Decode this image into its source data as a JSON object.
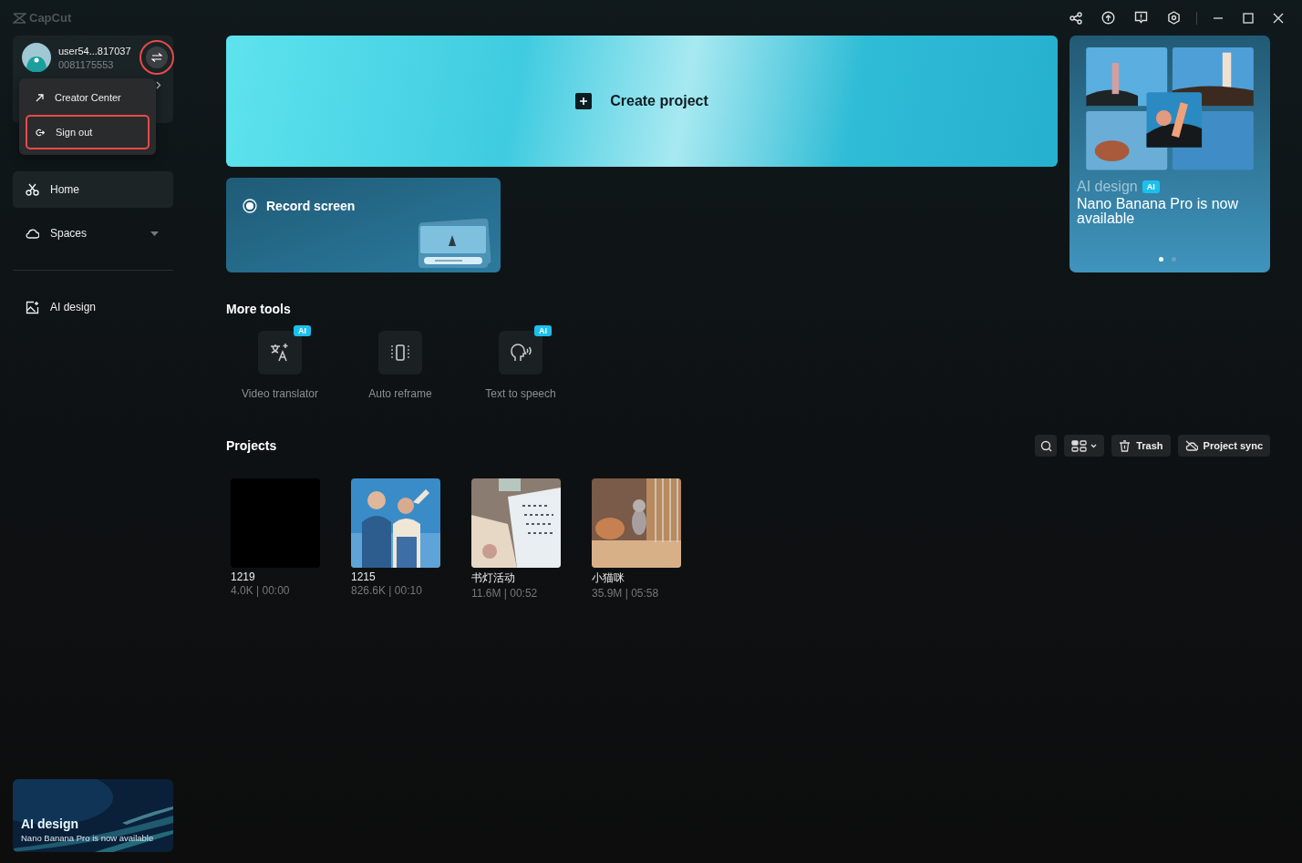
{
  "app": {
    "name": "CapCut"
  },
  "account": {
    "username": "user54...817037",
    "user_id": "0081175553",
    "switch_highlighted": true
  },
  "account_menu": {
    "items": [
      {
        "kind": "creator",
        "label": "Creator Center",
        "highlighted": false
      },
      {
        "kind": "signout",
        "label": "Sign out",
        "highlighted": true
      }
    ]
  },
  "sidebar": {
    "items": [
      {
        "kind": "home",
        "label": "Home",
        "selected": true,
        "dropdown": false
      },
      {
        "kind": "spaces",
        "label": "Spaces",
        "selected": false,
        "dropdown": true
      },
      {
        "kind": "aidesign",
        "label": "AI design",
        "selected": false,
        "dropdown": false
      }
    ],
    "promo": {
      "title": "AI design",
      "subtitle": "Nano Banana Pro is now available"
    }
  },
  "create_project": {
    "label": "Create project"
  },
  "record_screen": {
    "label": "Record screen"
  },
  "carousel": {
    "title": "AI design",
    "badge": "AI",
    "headline": "Nano Banana Pro is now available",
    "dots": [
      {
        "selected": true
      },
      {
        "selected": false
      }
    ]
  },
  "more_tools": {
    "title": "More tools",
    "tools": [
      {
        "kind": "translate",
        "label": "Video translator",
        "badge": "AI"
      },
      {
        "kind": "reframe",
        "label": "Auto reframe"
      },
      {
        "kind": "speech",
        "label": "Text to speech",
        "badge": "AI"
      }
    ]
  },
  "projects": {
    "title": "Projects",
    "trash": "Trash",
    "sync": "Project sync",
    "items": [
      {
        "kind": "blank",
        "name": "1219",
        "meta": "4.0K | 00:00"
      },
      {
        "kind": "people",
        "name": "1215",
        "meta": "826.6K | 00:10"
      },
      {
        "kind": "paper",
        "name": "书灯活动",
        "meta": "11.6M | 00:52"
      },
      {
        "kind": "cat",
        "name": "小猫咪",
        "meta": "35.9M | 05:58"
      }
    ]
  }
}
